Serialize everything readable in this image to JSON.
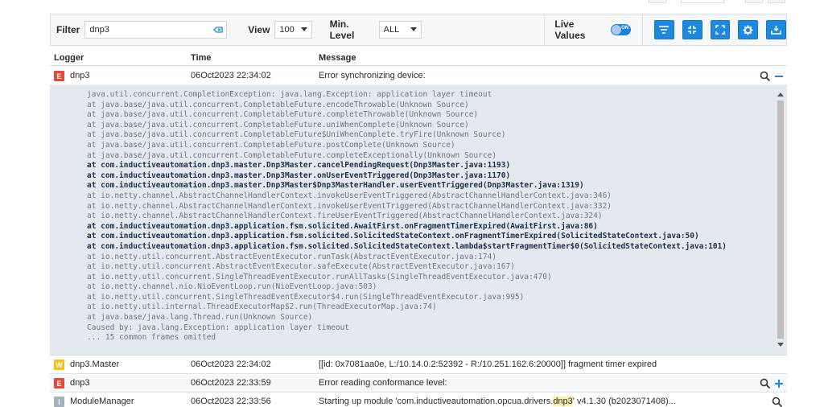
{
  "toolbar": {
    "filter_label": "Filter",
    "filter_value": "dnp3",
    "view_label": "View",
    "view_value": "100",
    "min_level_label": "Min. Level",
    "min_level_value": "ALL",
    "live_values_label": "Live Values",
    "live_toggle_text": "ON",
    "live_values_on": true,
    "accent_color": "#1d88df"
  },
  "columns": {
    "logger": "Logger",
    "time": "Time",
    "message": "Message"
  },
  "rows": [
    {
      "level": "E",
      "logger": "dnp3",
      "time": "06Oct2023 22:34:02",
      "message": "Error synchronizing device:"
    },
    {
      "level": "W",
      "logger": "dnp3.Master",
      "time": "06Oct2023 22:34:02",
      "message": "[[id: 0x7081aa0e, L:/10.14.0.2:52392 - R:/10.251.162.6:20000]] fragment timer expired"
    },
    {
      "level": "E",
      "logger": "dnp3",
      "time": "06Oct2023 22:33:59",
      "message": "Error reading conformance level:"
    },
    {
      "level": "I",
      "logger": "ModuleManager",
      "time": "06Oct2023 22:33:56",
      "message_pre": "Starting up module 'com.inductiveautomation.opcua.drivers.",
      "message_hl": "dnp3",
      "message_post": "' v4.1.30 (b2023071408)..."
    }
  ],
  "stack_trace": [
    {
      "text": "java.util.concurrent.CompletionException: java.lang.Exception: application layer timeout",
      "bold": false
    },
    {
      "text": "at java.base/java.util.concurrent.CompletableFuture.encodeThrowable(Unknown Source)",
      "bold": false
    },
    {
      "text": "at java.base/java.util.concurrent.CompletableFuture.completeThrowable(Unknown Source)",
      "bold": false
    },
    {
      "text": "at java.base/java.util.concurrent.CompletableFuture.uniWhenComplete(Unknown Source)",
      "bold": false
    },
    {
      "text": "at java.base/java.util.concurrent.CompletableFuture$UniWhenComplete.tryFire(Unknown Source)",
      "bold": false
    },
    {
      "text": "at java.base/java.util.concurrent.CompletableFuture.postComplete(Unknown Source)",
      "bold": false
    },
    {
      "text": "at java.base/java.util.concurrent.CompletableFuture.completeExceptionally(Unknown Source)",
      "bold": false
    },
    {
      "text": "at com.inductiveautomation.dnp3.master.Dnp3Master.cancelPendingRequest(Dnp3Master.java:1193)",
      "bold": true
    },
    {
      "text": "at com.inductiveautomation.dnp3.master.Dnp3Master.onUserEventTriggered(Dnp3Master.java:1170)",
      "bold": true
    },
    {
      "text": "at com.inductiveautomation.dnp3.master.Dnp3Master$Dnp3MasterHandler.userEventTriggered(Dnp3Master.java:1319)",
      "bold": true
    },
    {
      "text": "at io.netty.channel.AbstractChannelHandlerContext.invokeUserEventTriggered(AbstractChannelHandlerContext.java:346)",
      "bold": false
    },
    {
      "text": "at io.netty.channel.AbstractChannelHandlerContext.invokeUserEventTriggered(AbstractChannelHandlerContext.java:332)",
      "bold": false
    },
    {
      "text": "at io.netty.channel.AbstractChannelHandlerContext.fireUserEventTriggered(AbstractChannelHandlerContext.java:324)",
      "bold": false
    },
    {
      "text": "at com.inductiveautomation.dnp3.application.fsm.solicited.AwaitFirst.onFragmentTimerExpired(AwaitFirst.java:86)",
      "bold": true
    },
    {
      "text": "at com.inductiveautomation.dnp3.application.fsm.solicited.SolicitedStateContext.onFragmentTimerExpired(SolicitedStateContext.java:50)",
      "bold": true
    },
    {
      "text": "at com.inductiveautomation.dnp3.application.fsm.solicited.SolicitedStateContext.lambda$startFragmentTimer$0(SolicitedStateContext.java:101)",
      "bold": true
    },
    {
      "text": "at io.netty.util.concurrent.AbstractEventExecutor.runTask(AbstractEventExecutor.java:174)",
      "bold": false
    },
    {
      "text": "at io.netty.util.concurrent.AbstractEventExecutor.safeExecute(AbstractEventExecutor.java:167)",
      "bold": false
    },
    {
      "text": "at io.netty.util.concurrent.SingleThreadEventExecutor.runAllTasks(SingleThreadEventExecutor.java:470)",
      "bold": false
    },
    {
      "text": "at io.netty.channel.nio.NioEventLoop.run(NioEventLoop.java:503)",
      "bold": false
    },
    {
      "text": "at io.netty.util.concurrent.SingleThreadEventExecutor$4.run(SingleThreadEventExecutor.java:995)",
      "bold": false
    },
    {
      "text": "at io.netty.util.internal.ThreadExecutorMap$2.run(ThreadExecutorMap.java:74)",
      "bold": false
    },
    {
      "text": "at java.base/java.lang.Thread.run(Unknown Source)",
      "bold": false
    },
    {
      "text": "Caused by: java.lang.Exception: application layer timeout",
      "bold": false
    },
    {
      "text": "... 15 common frames omitted",
      "bold": false
    }
  ],
  "icons": {
    "clear_filter": "clear-filter-icon",
    "filter": "filter-icon",
    "collapse": "collapse-icon",
    "expand": "expand-icon",
    "settings": "gear-icon",
    "download": "download-icon",
    "search": "search-icon",
    "collapse_row": "minus-icon",
    "expand_row": "plus-icon"
  },
  "colors": {
    "error": "#e2493b",
    "warn": "#f4c01a",
    "info": "#a7b1bc",
    "trace_bg": "#e4e9ef"
  }
}
